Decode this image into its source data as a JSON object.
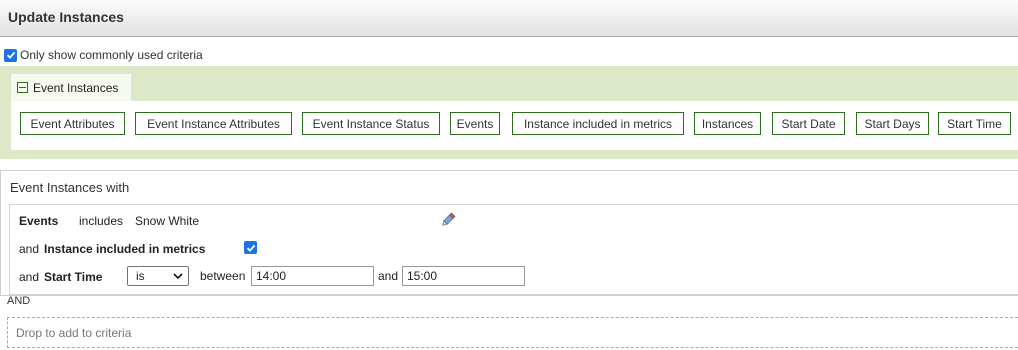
{
  "header": {
    "title": "Update Instances"
  },
  "filter": {
    "only_common_label": "Only show commonly used criteria",
    "checked": true
  },
  "tab": {
    "label": "Event Instances"
  },
  "criteria_buttons": [
    "Event Attributes",
    "Event Instance Attributes",
    "Event Instance Status",
    "Events",
    "Instance included in metrics",
    "Instances",
    "Start Date",
    "Start Days",
    "Start Time"
  ],
  "builder": {
    "title": "Event Instances with",
    "row1": {
      "field": "Events",
      "operator": "includes",
      "value": "Snow White"
    },
    "row2": {
      "prefix": "and",
      "field": "Instance included in metrics",
      "checked": true
    },
    "row3": {
      "prefix": "and",
      "field": "Start Time",
      "operator": "is",
      "between_label": "between",
      "from": "14:00",
      "and_label": "and",
      "to": "15:00"
    }
  },
  "and_separator": "AND",
  "drop_zone": {
    "placeholder": "Drop to add to criteria"
  },
  "colors": {
    "panel_bg": "#dde8c8",
    "chip_border": "#2f6e1f",
    "checkbox": "#1a73e8"
  },
  "icons": {
    "edit": "pencil-icon",
    "collapse": "minus-icon",
    "dropdown": "chevron-down-icon"
  }
}
